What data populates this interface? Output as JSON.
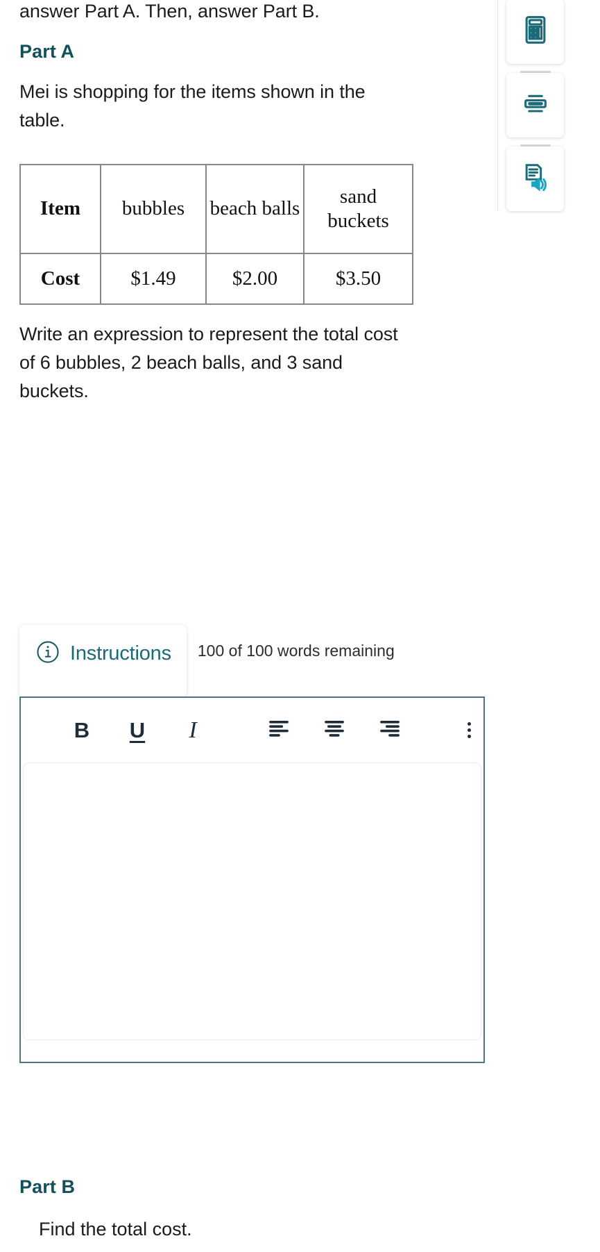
{
  "question": {
    "intro": "answer Part A. Then, answer Part B.",
    "part_a_heading": "Part A",
    "part_a_prompt": "Mei is shopping for the items shown in the table.",
    "part_a_task": "Write an expression to represent the total cost of 6 bubbles, 2 beach balls, and 3 sand buckets.",
    "part_b_heading": "Part B",
    "part_b_text": "Find the total cost."
  },
  "table": {
    "rows": [
      {
        "label": "Item",
        "cells": [
          "bubbles",
          "beach balls",
          "sand buckets"
        ]
      },
      {
        "label": "Cost",
        "cells": [
          "$1.49",
          "$2.00",
          "$3.50"
        ]
      }
    ]
  },
  "tool_rail": {
    "buttons": [
      {
        "icon": "calculator-icon",
        "name": "calculator-tool"
      },
      {
        "icon": "line-reader-icon",
        "name": "line-reader-tool"
      },
      {
        "icon": "text-to-speech-icon",
        "name": "text-to-speech-tool"
      }
    ]
  },
  "instructions": {
    "label": "Instructions",
    "icon": "info-circle-icon"
  },
  "word_counter": {
    "text": "100 of 100 words remaining",
    "used": 0,
    "limit": 100
  },
  "editor": {
    "toolbar": [
      {
        "name": "bold-button",
        "label": "B",
        "icon": "bold-icon"
      },
      {
        "name": "underline-button",
        "label": "U",
        "icon": "underline-icon"
      },
      {
        "name": "italic-button",
        "label": "I",
        "icon": "italic-icon"
      },
      {
        "name": "align-left-button",
        "label": "",
        "icon": "align-left-icon"
      },
      {
        "name": "align-center-button",
        "label": "",
        "icon": "align-center-icon"
      },
      {
        "name": "align-right-button",
        "label": "",
        "icon": "align-right-icon"
      },
      {
        "name": "more-options-button",
        "label": "",
        "icon": "vertical-dots-icon"
      }
    ],
    "value": "",
    "placeholder": ""
  },
  "colors": {
    "heading": "#12505c",
    "accent": "#1b6a78",
    "editor_border": "#4d7581",
    "table_border": "#878787",
    "text": "#1b1b1b"
  }
}
